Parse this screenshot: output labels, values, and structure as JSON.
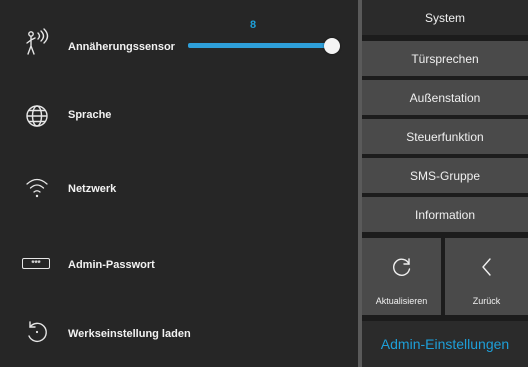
{
  "settings": {
    "proximity": {
      "label": "Annäherungssensor",
      "value": "8",
      "level_percent": 100,
      "icon": "proximity-sensor-icon"
    },
    "language": {
      "label": "Sprache",
      "icon": "globe-icon"
    },
    "network": {
      "label": "Netzwerk",
      "icon": "wifi-icon"
    },
    "admin_password": {
      "label": "Admin-Passwort",
      "icon_text": "***",
      "icon": "password-icon"
    },
    "factory_reset": {
      "label": "Werkseinstellung laden",
      "icon": "restore-icon"
    }
  },
  "menu": {
    "items": [
      {
        "label": "System",
        "active": true
      },
      {
        "label": "Türsprechen",
        "active": false
      },
      {
        "label": "Außenstation",
        "active": false
      },
      {
        "label": "Steuerfunktion",
        "active": false
      },
      {
        "label": "SMS-Gruppe",
        "active": false
      },
      {
        "label": "Information",
        "active": false
      }
    ],
    "refresh_label": "Aktualisieren",
    "back_label": "Zurück",
    "footer_title": "Admin-Einstellungen"
  },
  "colors": {
    "accent": "#1e9fd8",
    "panel": "#262626",
    "button": "#4a4a4a"
  }
}
